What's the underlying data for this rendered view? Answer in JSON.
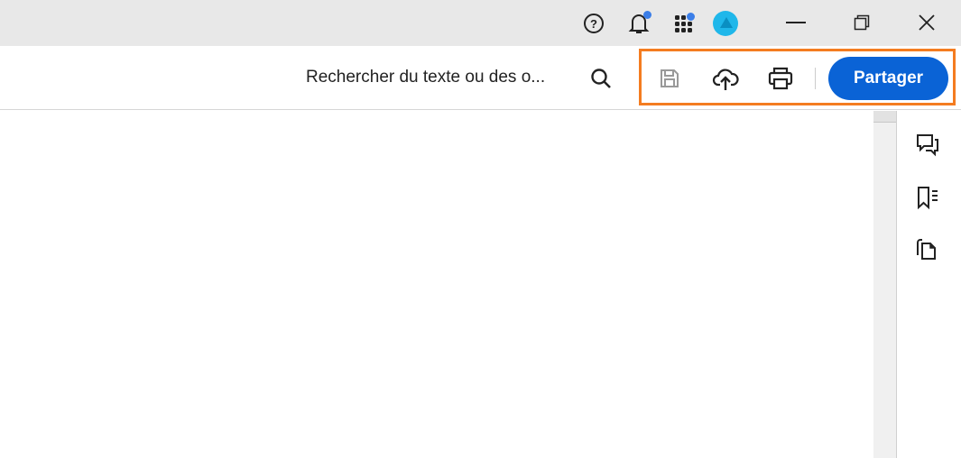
{
  "titlebar": {
    "icons": [
      "help-icon",
      "bell-icon",
      "apps-icon",
      "profile-avatar"
    ],
    "window_controls": [
      "minimize",
      "restore",
      "close"
    ]
  },
  "toolbar": {
    "search_label": "Rechercher du texte ou des o...",
    "share_label": "Partager",
    "accent": "#0a63d6",
    "highlight": "#f47c20"
  },
  "right_panel": {
    "icons": [
      "comments-icon",
      "bookmarks-icon",
      "pages-icon"
    ]
  }
}
